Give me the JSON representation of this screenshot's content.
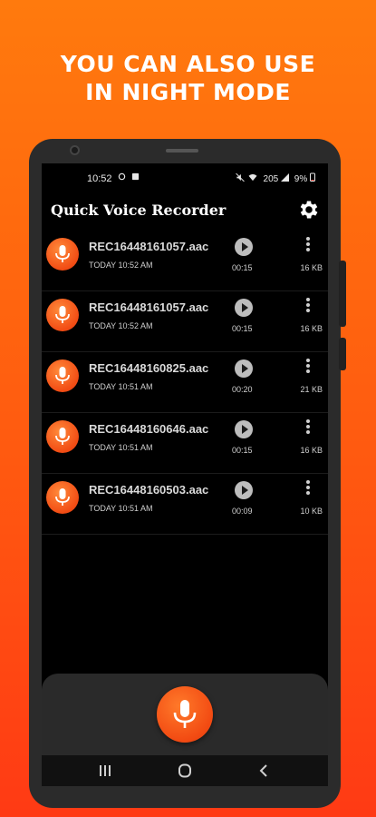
{
  "headline": {
    "line1": "YOU CAN ALSO USE",
    "line2": "IN NIGHT MODE"
  },
  "status_bar": {
    "time": "10:52",
    "battery": "9%",
    "signal_text": "205"
  },
  "app": {
    "title": "Quick Voice Recorder",
    "settings_icon": "gear-icon"
  },
  "recordings": [
    {
      "name": "REC16448161057.aac",
      "date": "TODAY 10:52 AM",
      "duration": "00:15",
      "size": "16 KB"
    },
    {
      "name": "REC16448161057.aac",
      "date": "TODAY 10:52 AM",
      "duration": "00:15",
      "size": "16 KB"
    },
    {
      "name": "REC16448160825.aac",
      "date": "TODAY 10:51 AM",
      "duration": "00:20",
      "size": "21 KB"
    },
    {
      "name": "REC16448160646.aac",
      "date": "TODAY 10:51 AM",
      "duration": "00:15",
      "size": "16 KB"
    },
    {
      "name": "REC16448160503.aac",
      "date": "TODAY 10:51 AM",
      "duration": "00:09",
      "size": "10 KB"
    }
  ],
  "icons": {
    "mic": "microphone-icon",
    "play": "play-icon",
    "more": "more-vertical-icon",
    "record": "record-microphone-icon"
  },
  "colors": {
    "background_top": "#ff7a0d",
    "background_bottom": "#ff3a14",
    "accent": "#f24c14",
    "screen": "#000000"
  }
}
